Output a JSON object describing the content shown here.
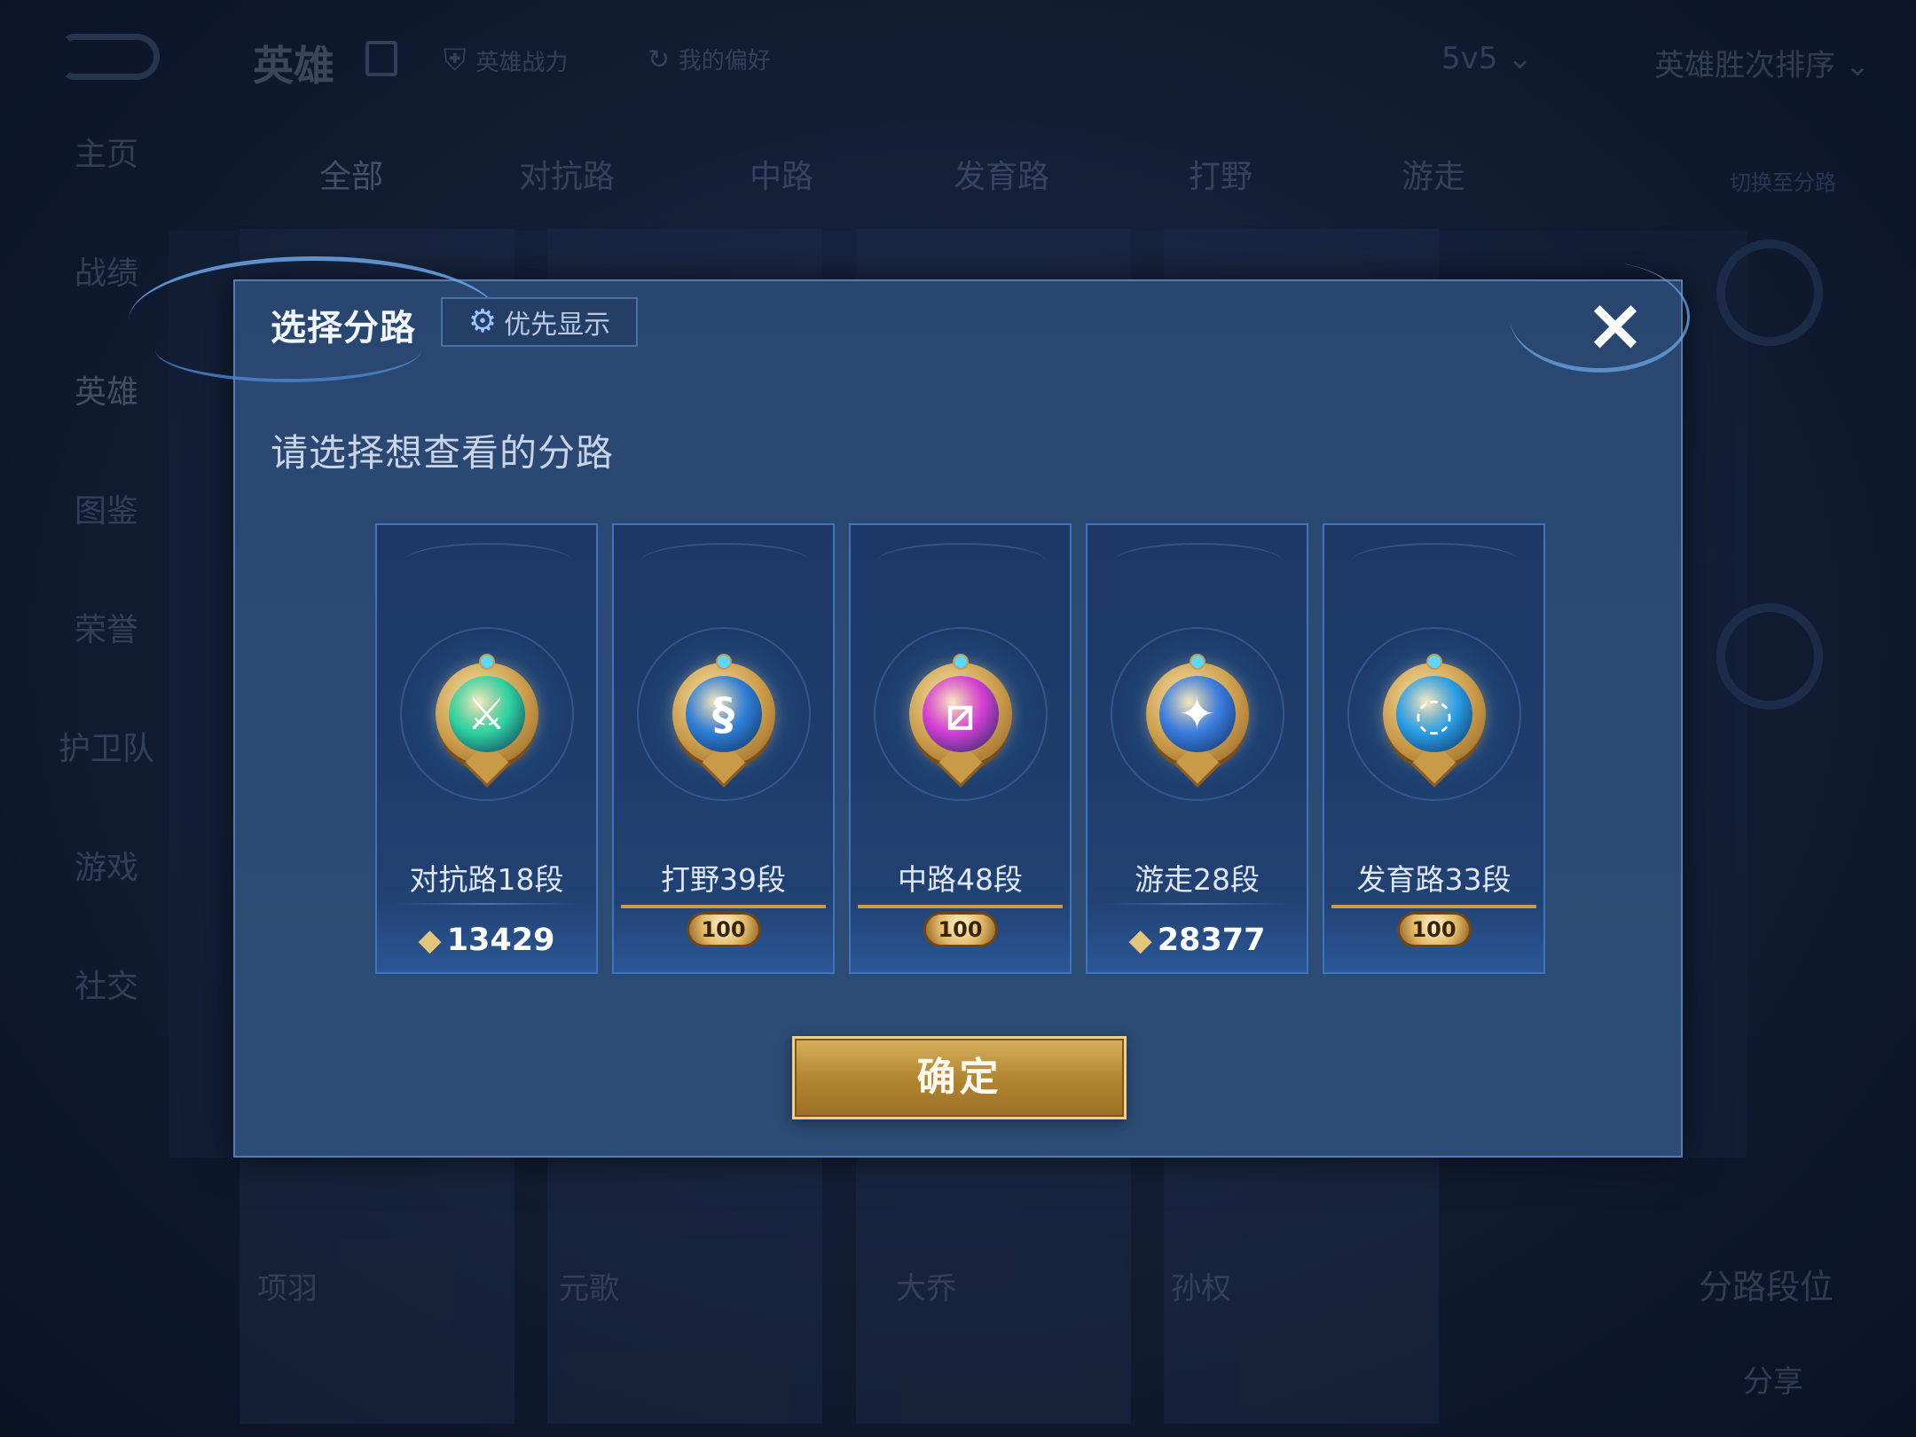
{
  "background": {
    "title": "英雄",
    "power_label": "英雄战力",
    "pref_label": "我的偏好",
    "mode": "5v5",
    "sort": "英雄胜次排序",
    "sidebar": [
      "主页",
      "战绩",
      "英雄",
      "图鉴",
      "荣誉",
      "护卫队",
      "游戏",
      "社交"
    ],
    "tabs": [
      "全部",
      "对抗路",
      "中路",
      "发育路",
      "打野",
      "游走"
    ],
    "tabs_right_link": "切换至分路",
    "card_names": [
      "项羽",
      "元歌",
      "大乔",
      "孙权"
    ],
    "lane_rank_label": "分路段位",
    "share_label": "分享"
  },
  "modal": {
    "title": "选择分路",
    "priority_button": "优先显示",
    "close_icon": "×",
    "subtitle": "请选择想查看的分路",
    "confirm": "确定",
    "lanes": [
      {
        "name": "对抗路18段",
        "score": "13429",
        "badge": null,
        "color": "#2fd3a1",
        "glyph": "⚔",
        "icon": "crossed-swords-emblem"
      },
      {
        "name": "打野39段",
        "score": null,
        "badge": "100",
        "color": "#2f7fd8",
        "glyph": "§",
        "icon": "dragon-emblem"
      },
      {
        "name": "中路48段",
        "score": null,
        "badge": "100",
        "color": "#d43ed6",
        "glyph": "⧄",
        "icon": "slash-emblem"
      },
      {
        "name": "游走28段",
        "score": "28377",
        "badge": null,
        "color": "#3a7de0",
        "glyph": "✦",
        "icon": "wing-emblem"
      },
      {
        "name": "发育路33段",
        "score": null,
        "badge": "100",
        "color": "#2a9fe8",
        "glyph": "◌",
        "icon": "shield-emblem"
      }
    ]
  }
}
